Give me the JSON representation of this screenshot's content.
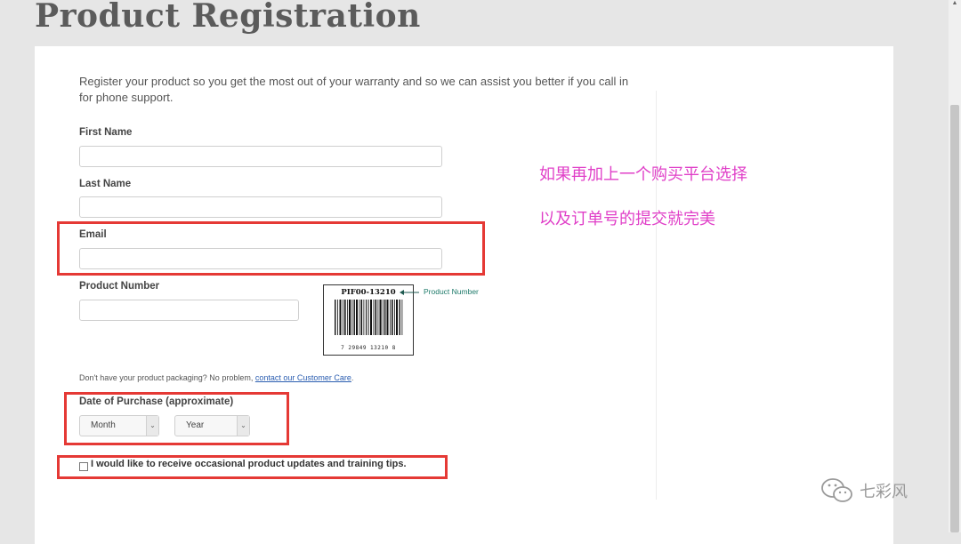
{
  "page": {
    "title": "Product Registration"
  },
  "form": {
    "intro": "Register your product so you get the most out of your warranty and so we can assist you better if you call in for phone support.",
    "first_name_label": "First Name",
    "first_name_value": "",
    "last_name_label": "Last Name",
    "last_name_value": "",
    "email_label": "Email",
    "email_value": "",
    "product_number_label": "Product Number",
    "product_number_value": "",
    "barcode": {
      "code": "PIF00-13210",
      "digits": "7 29849 13210 8",
      "callout": "Product Number"
    },
    "help_text_prefix": "Don't have your product packaging? No problem, ",
    "help_link": "contact our Customer Care",
    "help_text_suffix": ".",
    "date_label": "Date of Purchase (approximate)",
    "month_selected": "Month",
    "year_selected": "Year",
    "updates_checkbox_label": "I would like to receive occasional product updates and training tips.",
    "updates_checked": false
  },
  "annotations": {
    "note_line1": "如果再加上一个购买平台选择",
    "note_line2": "以及订单号的提交就完美",
    "highlight_color": "#e53935",
    "note_color": "#e040c8"
  },
  "watermark": {
    "text": "七彩风",
    "icon": "wechat-icon"
  }
}
